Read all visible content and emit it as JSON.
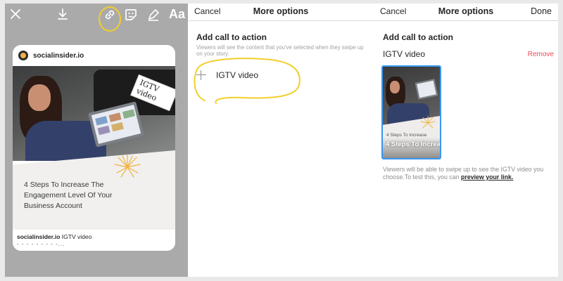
{
  "story_editor": {
    "tools": {
      "close": "close-icon",
      "download": "download-icon",
      "link": "link-icon",
      "sticker": "sticker-icon",
      "draw": "pen-icon",
      "text": "Aa"
    },
    "highlight_color": "#f2cf2a",
    "card": {
      "username": "socialinsider.io",
      "tag_label": "IGTV video",
      "title": "4 Steps To Increase The Engagement Level Of Your Business Account",
      "footer_user": "socialinsider.io",
      "footer_caption": "IGTV video",
      "footer_more": "- - - - - - - - -..."
    }
  },
  "add_cta_panel": {
    "cancel_label": "Cancel",
    "title": "More options",
    "section_title": "Add call to action",
    "helper_text": "Viewers will see the content that you've selected when they swipe up on your story.",
    "add_option_label": "IGTV video"
  },
  "selected_panel": {
    "cancel_label": "Cancel",
    "title": "More options",
    "done_label": "Done",
    "section_title": "Add call to action",
    "selected_name": "IGTV video",
    "remove_label": "Remove",
    "thumb_small_text": "4 Steps To Increase",
    "thumb_title": "4 Steps To Increase The...",
    "info_text": "Viewers will be able to swipe up to see the IGTV video you choose.To test this, you can ",
    "preview_link_label": "preview your link."
  },
  "colors": {
    "accent_blue": "#3897f0",
    "remove_red": "#ed4956",
    "highlight_yellow": "#f2cf2a"
  }
}
